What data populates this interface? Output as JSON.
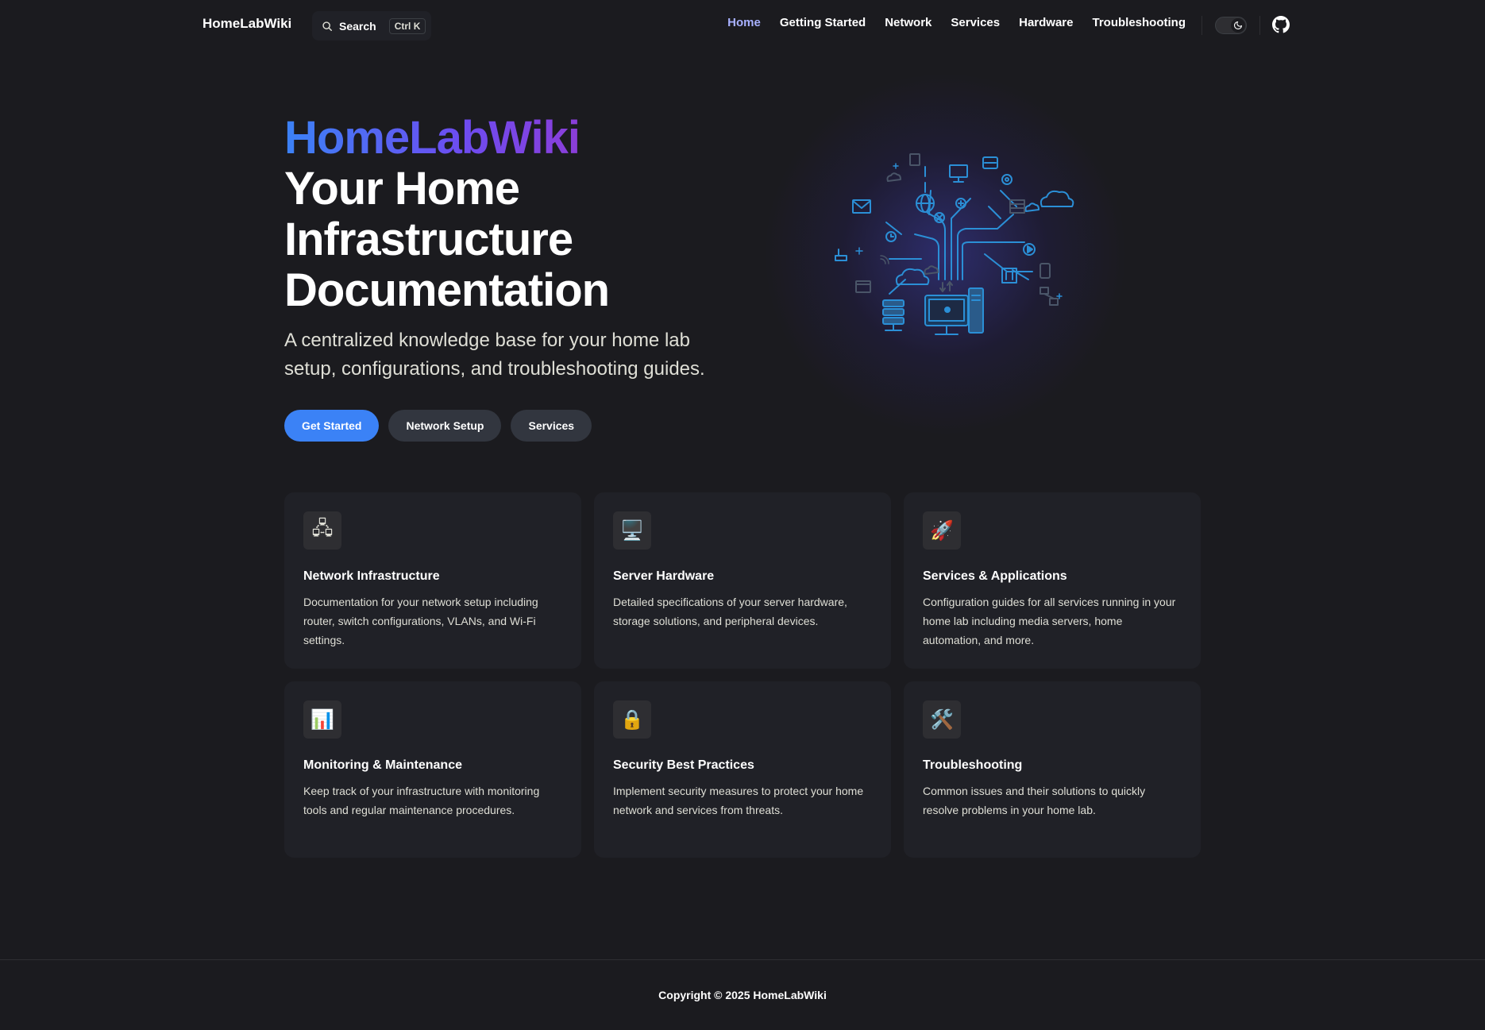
{
  "nav": {
    "brand": "HomeLabWiki",
    "search_label": "Search",
    "search_kbd": "Ctrl K",
    "links": [
      {
        "label": "Home",
        "active": true
      },
      {
        "label": "Getting Started"
      },
      {
        "label": "Network"
      },
      {
        "label": "Services"
      },
      {
        "label": "Hardware"
      },
      {
        "label": "Troubleshooting"
      }
    ],
    "theme_toggle_icon": "moon-icon",
    "github_icon": "github-icon"
  },
  "hero": {
    "name": "HomeLabWiki",
    "text": "Your Home Infrastructure Documentation",
    "tagline": "A centralized knowledge base for your home lab setup, configurations, and troubleshooting guides.",
    "actions": [
      {
        "label": "Get Started",
        "theme": "brand"
      },
      {
        "label": "Network Setup",
        "theme": "alt"
      },
      {
        "label": "Services",
        "theme": "alt"
      }
    ],
    "image": "network-infrastructure-illustration"
  },
  "features": [
    {
      "icon": "🖧",
      "icon_name": "network-icon",
      "title": "Network Infrastructure",
      "details": "Documentation for your network setup including router, switch configurations, VLANs, and Wi-Fi settings."
    },
    {
      "icon": "🖥️",
      "icon_name": "desktop-computer-icon",
      "title": "Server Hardware",
      "details": "Detailed specifications of your server hardware, storage solutions, and peripheral devices."
    },
    {
      "icon": "🚀",
      "icon_name": "rocket-icon",
      "title": "Services & Applications",
      "details": "Configuration guides for all services running in your home lab including media servers, home automation, and more."
    },
    {
      "icon": "📊",
      "icon_name": "bar-chart-icon",
      "title": "Monitoring & Maintenance",
      "details": "Keep track of your infrastructure with monitoring tools and regular maintenance procedures."
    },
    {
      "icon": "🔒",
      "icon_name": "lock-icon",
      "title": "Security Best Practices",
      "details": "Implement security measures to protect your home network and services from threats."
    },
    {
      "icon": "🛠️",
      "icon_name": "tools-icon",
      "title": "Troubleshooting",
      "details": "Common issues and their solutions to quickly resolve problems in your home lab."
    }
  ],
  "footer": {
    "copyright": "Copyright © 2025 HomeLabWiki"
  },
  "colors": {
    "background": "#1b1b1f",
    "card": "#202127",
    "brand": "#3b82f6",
    "active_link": "#a8b1ff",
    "illustration": "#2b8fd6"
  }
}
